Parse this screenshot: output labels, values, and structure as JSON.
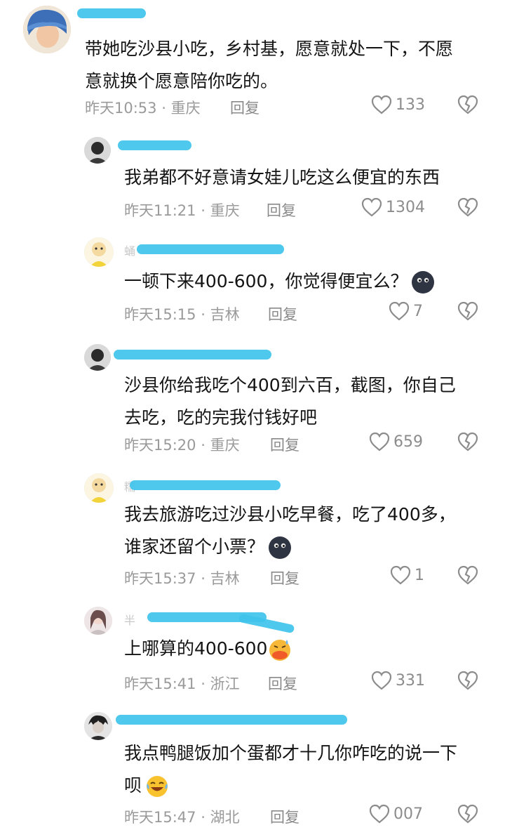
{
  "comments": [
    {
      "text_lines": [
        "带她吃沙县小吃，乡村基，愿意就处一下，不愿",
        "意就换个愿意陪你吃的。"
      ],
      "time": "昨天10:53",
      "location": "重庆",
      "reply": "回复",
      "likes": "133"
    },
    {
      "name_ghost": "",
      "text_lines": [
        "我弟都不好意请女娃儿吃这么便宜的东西"
      ],
      "time": "昨天11:21",
      "location": "重庆",
      "reply": "回复",
      "likes": "1304"
    },
    {
      "name_ghost": "蛹",
      "text_lines": [
        "一顿下来400-600，你觉得便宜么？"
      ],
      "emoji": "dark-face-emoji",
      "time": "昨天15:15",
      "location": "吉林",
      "reply": "回复",
      "likes": "7"
    },
    {
      "name_ghost": "",
      "text_lines": [
        "沙县你给我吃个400到六百，截图，你自己",
        "去吃，吃的完我付钱好吧"
      ],
      "time": "昨天15:20",
      "location": "重庆",
      "reply": "回复",
      "likes": "659"
    },
    {
      "name_ghost": "糯",
      "text_lines": [
        "我去旅游吃过沙县小吃早餐，吃了400多，",
        "谁家还留个小票？"
      ],
      "emoji": "dark-face-emoji",
      "time": "昨天15:37",
      "location": "吉林",
      "reply": "回复",
      "likes": "1"
    },
    {
      "name_ghost": "半",
      "text_lines": [
        "上哪算的400-600"
      ],
      "emoji": "sweat-duck-emoji",
      "time": "昨天15:41",
      "location": "浙江",
      "reply": "回复",
      "likes": "331"
    },
    {
      "name_ghost": "",
      "text_lines": [
        "我点鸭腿饭加个蛋都才十几你咋吃的说一下",
        "呗"
      ],
      "emoji": "laugh-cry-emoji",
      "time": "昨天15:47",
      "location": "湖北",
      "reply": "回复",
      "likes": "007"
    }
  ],
  "separator": "·",
  "colors": {
    "redact": "#3fc3ea",
    "meta": "#9a9a9a"
  }
}
